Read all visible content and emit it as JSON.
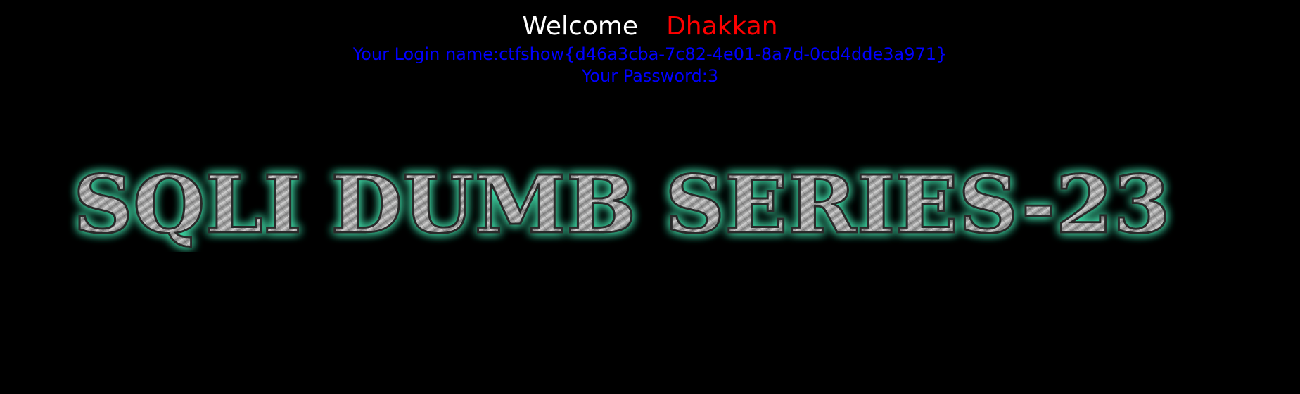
{
  "welcome": {
    "greeting": "Welcome",
    "name": "Dhakkan"
  },
  "login": {
    "label": "Your Login name:",
    "value": "ctfshow{d46a3cba-7c82-4e01-8a7d-0cd4dde3a971}"
  },
  "password": {
    "label": "Your Password:",
    "value": "3"
  },
  "banner": {
    "text": "SQLI DUMB SERIES-23"
  },
  "colors": {
    "background": "#000000",
    "greeting": "#ffffff",
    "name": "#ff0000",
    "info": "#0000ff",
    "banner_glow": "#3fd9a6",
    "banner_fill": "#9a9a9a"
  }
}
